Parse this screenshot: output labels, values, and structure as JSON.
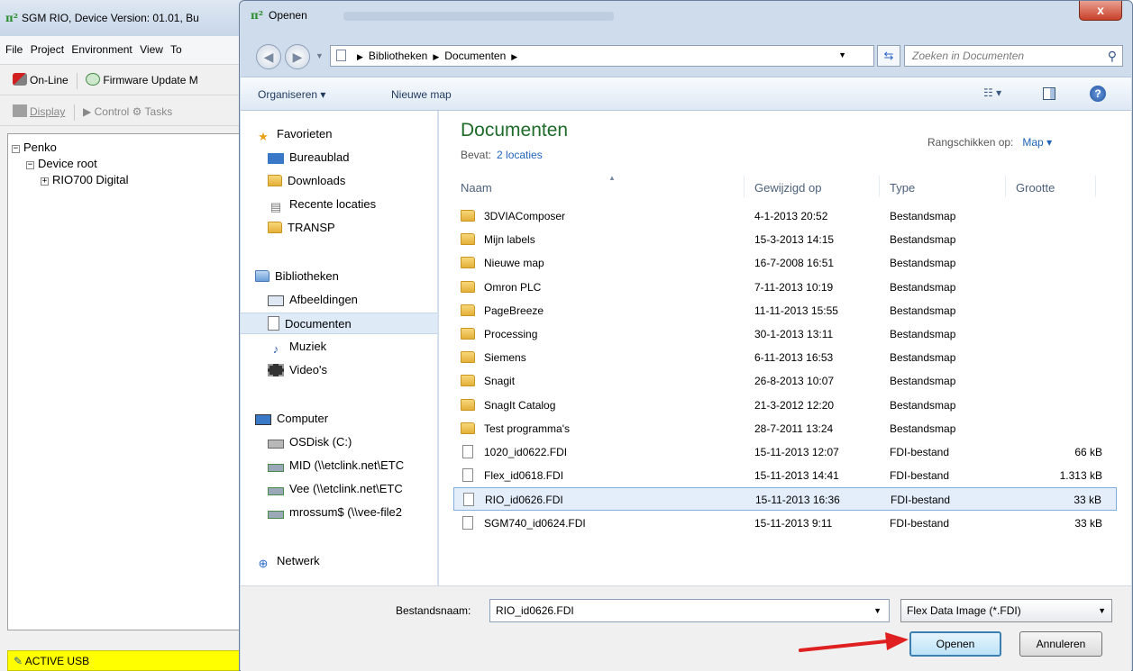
{
  "background_app": {
    "title": "SGM RIO, Device Version: 01.01, Bu",
    "menu": [
      "File",
      "Project",
      "Environment",
      "View",
      "To"
    ],
    "toolbar1": {
      "online": "On-Line",
      "firmware": "Firmware Update M"
    },
    "toolbar2": {
      "display": "Display",
      "control": "Control",
      "tasks": "Tasks"
    },
    "tree": [
      {
        "label": "Penko",
        "expander": "−"
      },
      {
        "label": "Device root",
        "expander": "−"
      },
      {
        "label": "RIO700 Digital",
        "expander": "+"
      }
    ],
    "status": "ACTIVE USB",
    "status_color": "#ffff00"
  },
  "dialog": {
    "title": "Openen",
    "close_glyph": "x",
    "address": {
      "part1": "Bibliotheken",
      "part2": "Documenten"
    },
    "search_placeholder": "Zoeken in Documenten",
    "toolbar": {
      "organize": "Organiseren ▾",
      "new_folder": "Nieuwe map"
    },
    "nav": {
      "favorites_header": "Favorieten",
      "favorites": [
        "Bureaublad",
        "Downloads",
        "Recente locaties",
        "TRANSP"
      ],
      "libraries_header": "Bibliotheken",
      "libraries": [
        "Afbeeldingen",
        "Documenten",
        "Muziek",
        "Video's"
      ],
      "computer_header": "Computer",
      "drives": [
        "OSDisk (C:)",
        "MID (\\\\etclink.net\\ETC",
        "Vee (\\\\etclink.net\\ETC",
        "mrossum$ (\\\\vee-file2"
      ],
      "network_header": "Netwerk"
    },
    "content": {
      "library_title": "Documenten",
      "contains_label": "Bevat:",
      "locations": "2 locaties",
      "arrange_label": "Rangschikken op:",
      "arrange_value": "Map ▾",
      "columns": {
        "name": "Naam",
        "modified": "Gewijzigd op",
        "type": "Type",
        "size": "Grootte"
      },
      "files": [
        {
          "name": "3DVIAComposer",
          "modified": "4-1-2013 20:52",
          "type": "Bestandsmap",
          "size": "",
          "kind": "folder"
        },
        {
          "name": "Mijn labels",
          "modified": "15-3-2013 14:15",
          "type": "Bestandsmap",
          "size": "",
          "kind": "folder"
        },
        {
          "name": "Nieuwe map",
          "modified": "16-7-2008 16:51",
          "type": "Bestandsmap",
          "size": "",
          "kind": "folder"
        },
        {
          "name": "Omron PLC",
          "modified": "7-11-2013 10:19",
          "type": "Bestandsmap",
          "size": "",
          "kind": "folder"
        },
        {
          "name": "PageBreeze",
          "modified": "11-11-2013 15:55",
          "type": "Bestandsmap",
          "size": "",
          "kind": "folder"
        },
        {
          "name": "Processing",
          "modified": "30-1-2013 13:11",
          "type": "Bestandsmap",
          "size": "",
          "kind": "folder"
        },
        {
          "name": "Siemens",
          "modified": "6-11-2013 16:53",
          "type": "Bestandsmap",
          "size": "",
          "kind": "folder"
        },
        {
          "name": "Snagit",
          "modified": "26-8-2013 10:07",
          "type": "Bestandsmap",
          "size": "",
          "kind": "folder"
        },
        {
          "name": "SnagIt Catalog",
          "modified": "21-3-2012 12:20",
          "type": "Bestandsmap",
          "size": "",
          "kind": "folder"
        },
        {
          "name": "Test programma's",
          "modified": "28-7-2011 13:24",
          "type": "Bestandsmap",
          "size": "",
          "kind": "folder"
        },
        {
          "name": "1020_id0622.FDI",
          "modified": "15-11-2013 12:07",
          "type": "FDI-bestand",
          "size": "66 kB",
          "kind": "file"
        },
        {
          "name": "Flex_id0618.FDI",
          "modified": "15-11-2013 14:41",
          "type": "FDI-bestand",
          "size": "1.313 kB",
          "kind": "file"
        },
        {
          "name": "RIO_id0626.FDI",
          "modified": "15-11-2013 16:36",
          "type": "FDI-bestand",
          "size": "33 kB",
          "kind": "file",
          "selected": true
        },
        {
          "name": "SGM740_id0624.FDI",
          "modified": "15-11-2013 9:11",
          "type": "FDI-bestand",
          "size": "33 kB",
          "kind": "file"
        }
      ]
    },
    "footer": {
      "filename_label": "Bestandsnaam:",
      "filename_value": "RIO_id0626.FDI",
      "filter_value": "Flex Data Image (*.FDI)",
      "open_label": "Openen",
      "cancel_label": "Annuleren"
    },
    "colors": {
      "accent_link": "#1f64b8",
      "title_green": "#1e6b2a",
      "arrow_red": "#e02020"
    }
  }
}
